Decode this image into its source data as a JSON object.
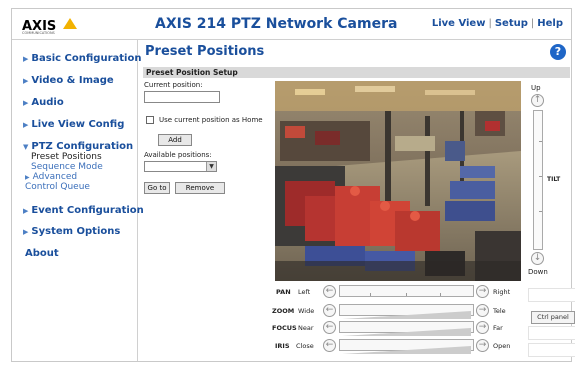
{
  "header": {
    "logo_text": "AXIS",
    "logo_tagline": "COMMUNICATIONS",
    "title": "AXIS 214 PTZ Network Camera",
    "links": [
      "Live View",
      "Setup",
      "Help"
    ]
  },
  "sidebar": {
    "items": [
      {
        "label": "Basic Configuration"
      },
      {
        "label": "Video & Image"
      },
      {
        "label": "Audio"
      },
      {
        "label": "Live View Config"
      },
      {
        "label": "PTZ Configuration"
      },
      {
        "label": "Event Configuration"
      },
      {
        "label": "System Options"
      },
      {
        "label": "About"
      }
    ],
    "ptz_sub": {
      "preset_positions": "Preset Positions",
      "sequence_mode": "Sequence Mode",
      "advanced": "Advanced",
      "control_queue": "Control Queue"
    }
  },
  "main": {
    "page_title": "Preset Positions",
    "section_title": "Preset Position Setup",
    "current_position_label": "Current position:",
    "current_position_value": "",
    "use_current_label": "Use current position as Home",
    "add_label": "Add",
    "available_positions_label": "Available positions:",
    "available_positions_selected": "",
    "goto_label": "Go to",
    "remove_label": "Remove"
  },
  "controls": {
    "tilt": {
      "top": "Up",
      "side": "TILT",
      "bottom": "Down"
    },
    "pan": {
      "name": "PAN",
      "min": "Left",
      "max": "Right"
    },
    "zoom": {
      "name": "ZOOM",
      "min": "Wide",
      "max": "Tele"
    },
    "focus": {
      "name": "FOCUS",
      "min": "Near",
      "max": "Far"
    },
    "iris": {
      "name": "IRIS",
      "min": "Close",
      "max": "Open"
    },
    "ctrl_panel_label": "Ctrl panel"
  },
  "icons": {
    "help": "help-icon",
    "arrow": "triangle-right-icon",
    "chevron": "chevron-icon"
  },
  "colors": {
    "link_blue": "#1a4f9c",
    "logo_yellow": "#f2b200",
    "section_gray": "#d9d9d9"
  }
}
